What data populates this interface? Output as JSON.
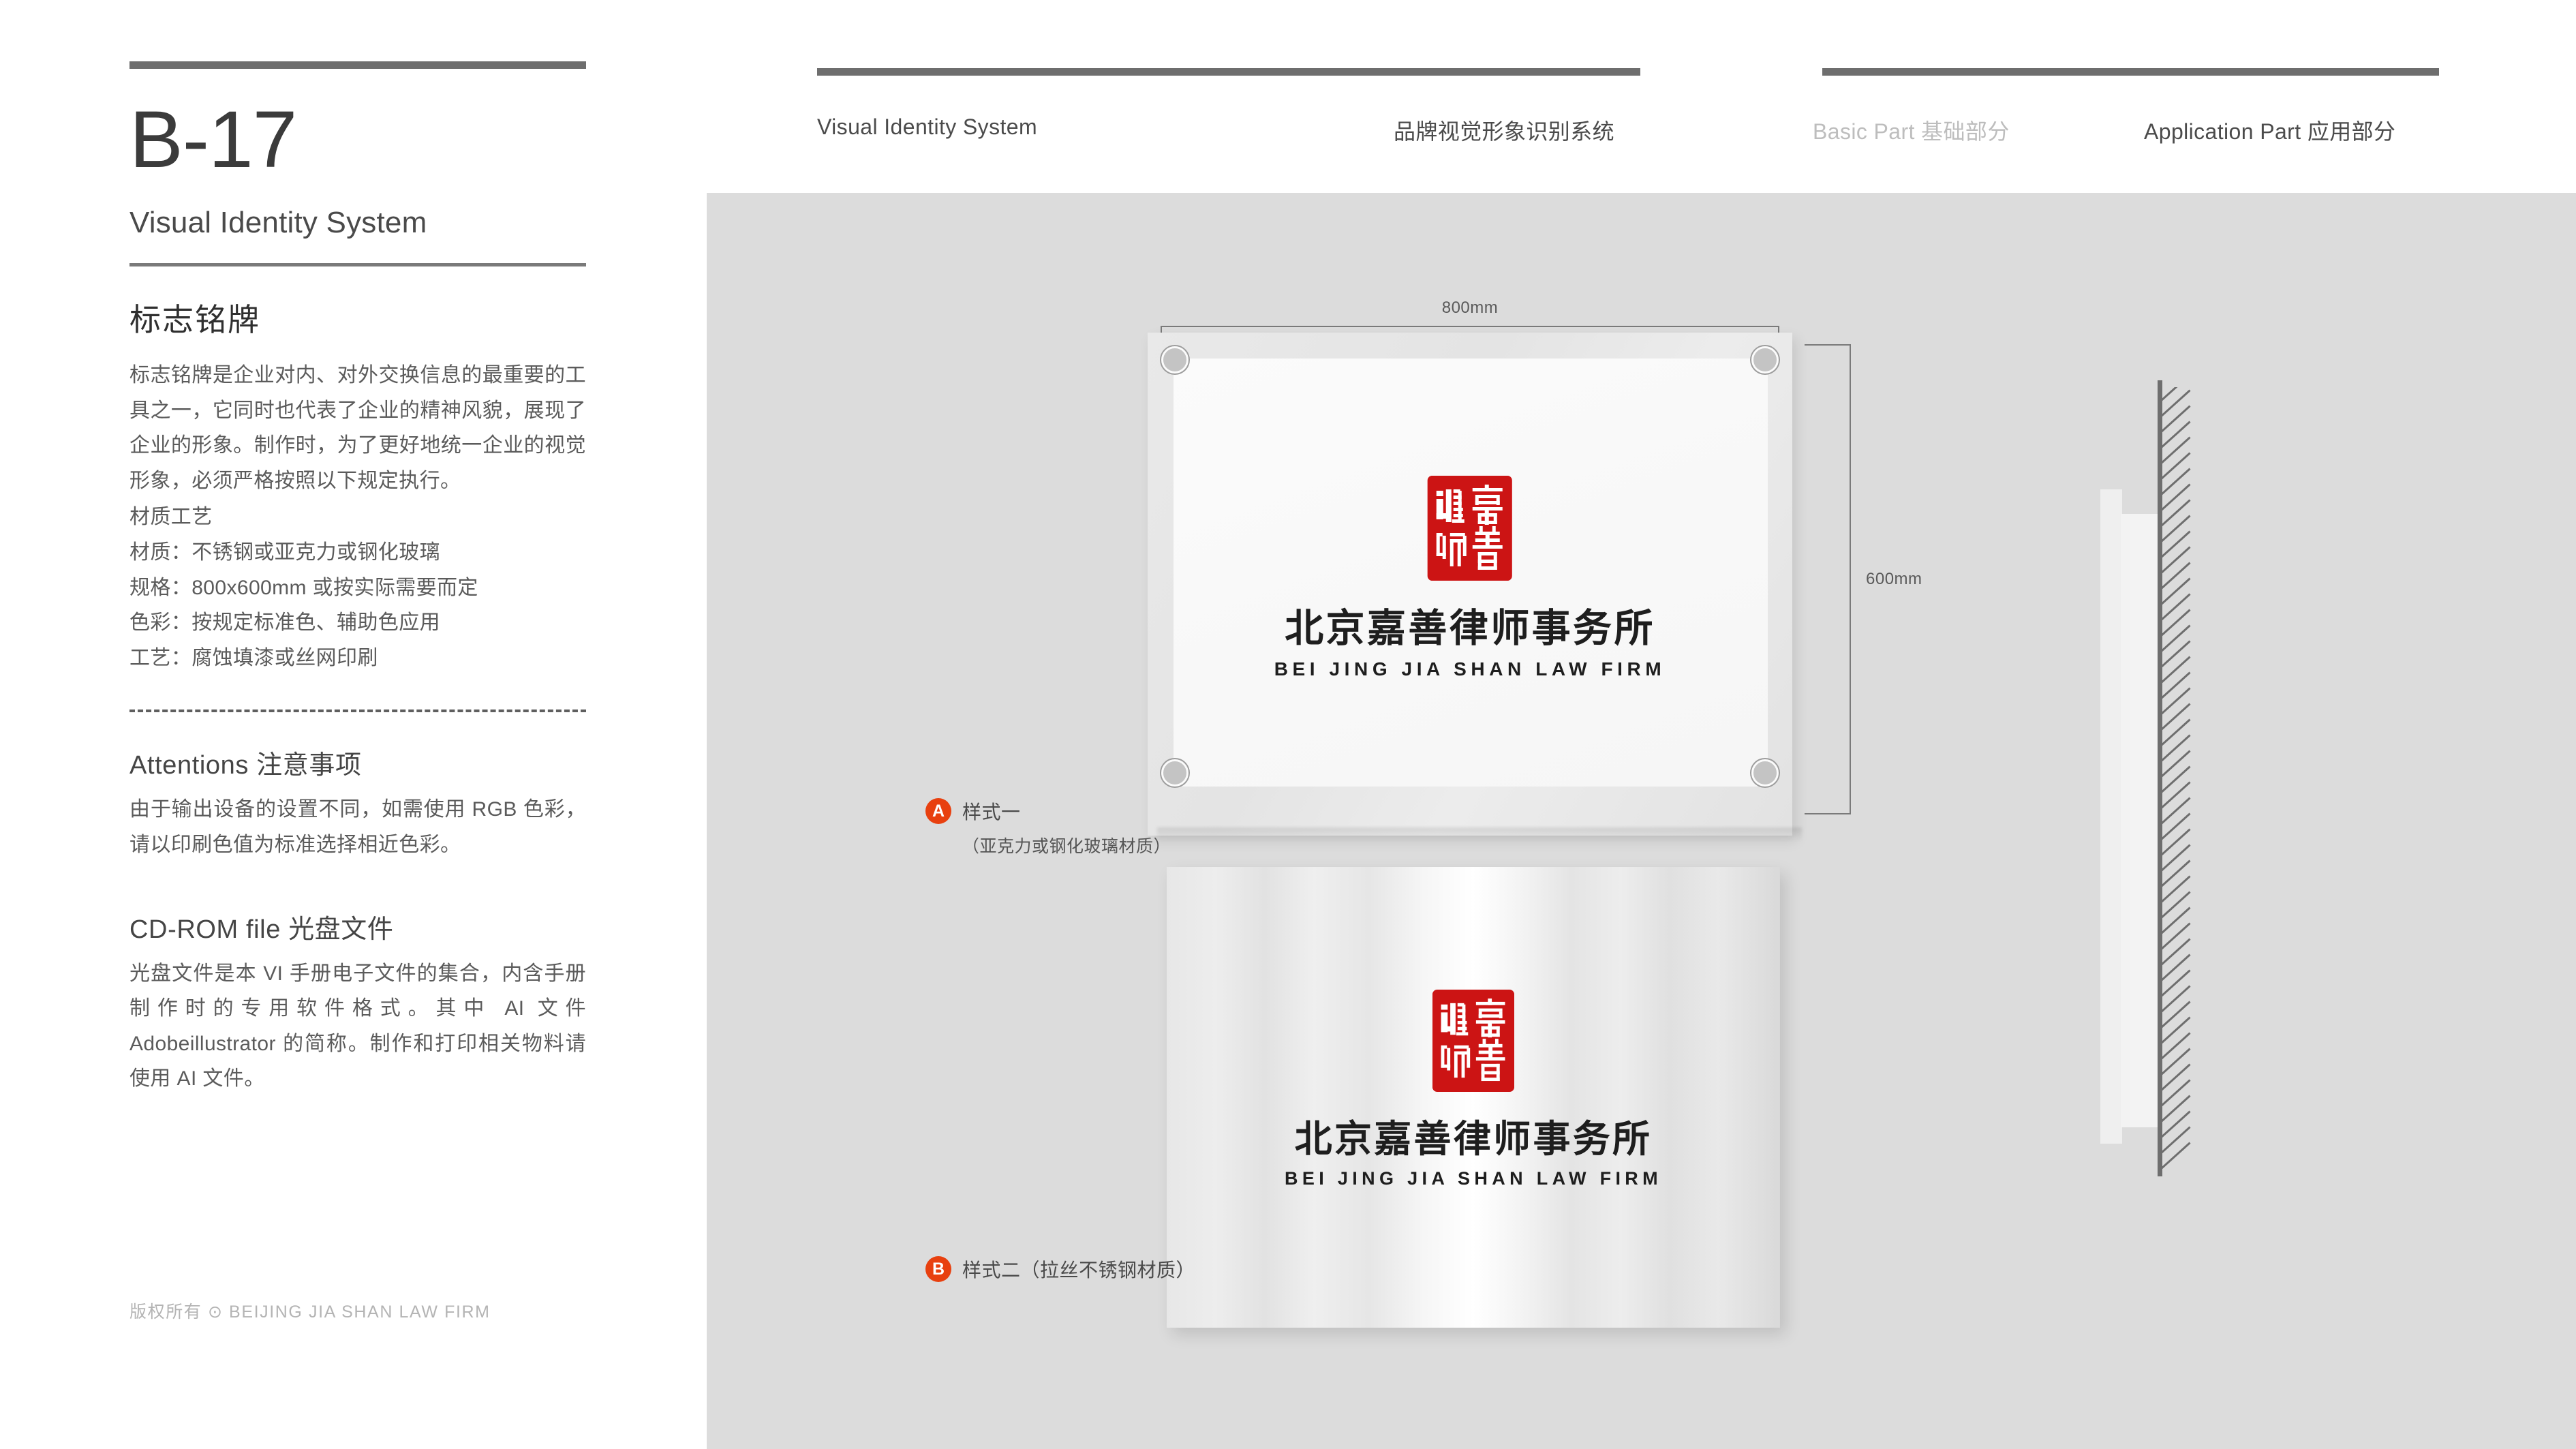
{
  "left": {
    "code": "B-17",
    "code_sub": "Visual Identity System",
    "section_title": "标志铭牌",
    "intro": "标志铭牌是企业对内、对外交换信息的最重要的工具之一，它同时也代表了企业的精神风貌，展现了企业的形象。制作时，为了更好地统一企业的视觉形象，必须严格按照以下规定执行。",
    "spec_heading": "材质工艺",
    "specs": [
      "材质：不锈钢或亚克力或钢化玻璃",
      "规格：800x600mm 或按实际需要而定",
      "色彩：按规定标准色、辅助色应用",
      "工艺：腐蚀填漆或丝网印刷"
    ],
    "attentions_heading": "Attentions 注意事项",
    "attentions_body": "由于输出设备的设置不同，如需使用 RGB 色彩，请以印刷色值为标准选择相近色彩。",
    "cdrom_heading": "CD-ROM file 光盘文件",
    "cdrom_body": "光盘文件是本 VI 手册电子文件的集合，内含手册制作时的专用软件格式。其中 AI 文件 Adobeillustrator 的简称。制作和打印相关物料请使用 AI 文件。",
    "copyright": "版权所有 ⊙ BEIJING JIA SHAN LAW FIRM"
  },
  "nav": {
    "item1": "Visual Identity System",
    "item2": "品牌视觉形象识别系统",
    "item3": "Basic Part 基础部分",
    "item4": "Application Part 应用部分"
  },
  "canvas": {
    "dim_width": "800mm",
    "dim_height": "600mm"
  },
  "logo": {
    "seal_chars": {
      "tr": "嘉",
      "br": "善",
      "tl": "律",
      "bl": "师"
    },
    "name_cn": "北京嘉善律师事务所",
    "name_en": "BEI JING JIA SHAN LAW FIRM"
  },
  "callouts": {
    "a": {
      "badge": "A",
      "label": "样式一",
      "sublabel": "（亚克力或钢化玻璃材质）"
    },
    "b": {
      "badge": "B",
      "label": "样式二（拉丝不锈钢材质）",
      "sublabel": ""
    }
  },
  "colors": {
    "seal_red": "#cc1414",
    "badge_orange": "#e8400f",
    "rule_gray": "#6e6e6e",
    "canvas_gray": "#dcdcdc",
    "text_gray": "#5b5b5b",
    "nav_inactive": "#bdbdbd"
  }
}
